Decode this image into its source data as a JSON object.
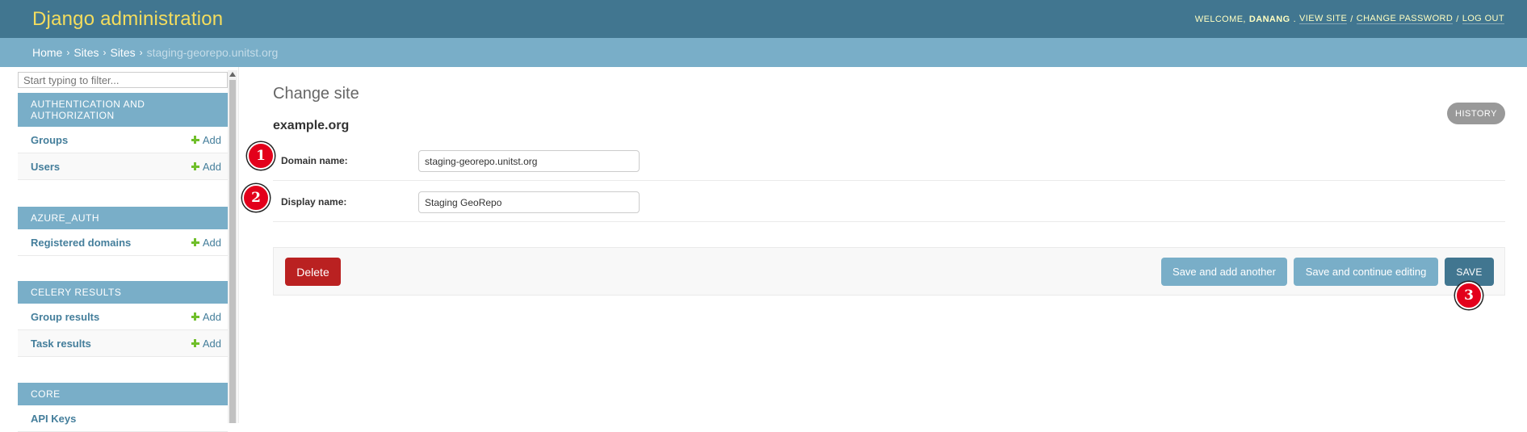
{
  "header": {
    "branding": "Django administration",
    "welcome_text": "WELCOME,",
    "username": "DANANG",
    "view_site": "VIEW SITE",
    "change_password": "CHANGE PASSWORD",
    "log_out": "LOG OUT",
    "separator": "/"
  },
  "breadcrumbs": {
    "items": [
      "Home",
      "Sites",
      "Sites"
    ],
    "separator": "›",
    "current": "staging-georepo.unitst.org"
  },
  "sidebar": {
    "filter_placeholder": "Start typing to filter...",
    "modules": [
      {
        "caption": "AUTHENTICATION AND AUTHORIZATION",
        "rows": [
          {
            "label": "Groups",
            "add": "Add"
          },
          {
            "label": "Users",
            "add": "Add"
          }
        ]
      },
      {
        "caption": "AZURE_AUTH",
        "rows": [
          {
            "label": "Registered domains",
            "add": "Add"
          }
        ]
      },
      {
        "caption": "CELERY RESULTS",
        "rows": [
          {
            "label": "Group results",
            "add": "Add"
          },
          {
            "label": "Task results",
            "add": "Add"
          }
        ]
      },
      {
        "caption": "CORE",
        "rows": [
          {
            "label": "API Keys",
            "add": ""
          }
        ]
      }
    ]
  },
  "main": {
    "page_title": "Change site",
    "object_title": "example.org",
    "history_label": "HISTORY",
    "fields": [
      {
        "label": "Domain name:",
        "value": "staging-georepo.unitst.org",
        "marker": "1"
      },
      {
        "label": "Display name:",
        "value": "Staging GeoRepo",
        "marker": "2"
      }
    ],
    "buttons": {
      "delete": "Delete",
      "save_add_another": "Save and add another",
      "save_continue": "Save and continue editing",
      "save": "SAVE",
      "save_marker": "3"
    }
  },
  "colors": {
    "header_bg": "#417690",
    "branding": "#f5dd5d",
    "breadcrumb_bg": "#79aec8",
    "link": "#447e9b",
    "delete_bg": "#ba2121",
    "marker_red": "#e3001b"
  }
}
